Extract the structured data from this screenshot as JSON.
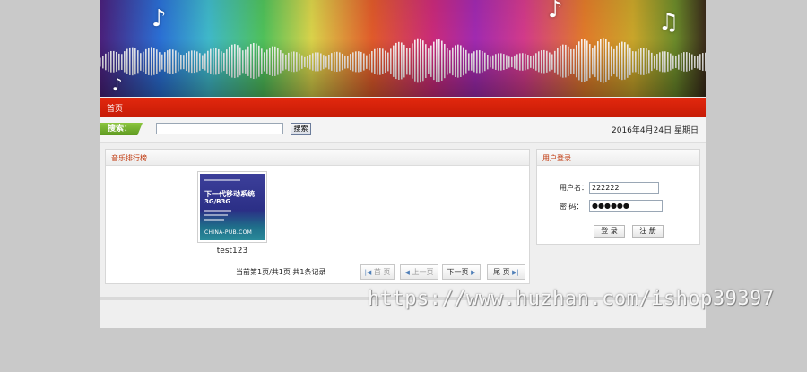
{
  "nav": {
    "home_label": "首页"
  },
  "search": {
    "label": "搜索：",
    "value": "",
    "placeholder": "",
    "button_label": "搜索"
  },
  "date_text": "2016年4月24日  星期日",
  "ranking_panel": {
    "title": "音乐排行榜",
    "song": {
      "name": "test123",
      "cover_title": "下一代移动系统",
      "cover_subtitle": "3G/B3G",
      "cover_brand": "CHINA-PUB.COM"
    },
    "pager": {
      "info": "当前第1页/共1页  共1条记录",
      "first_label": "首 页",
      "prev_label": "上一页",
      "next_label": "下一页",
      "last_label": "尾 页"
    }
  },
  "login_panel": {
    "title": "用户登录",
    "username_label": "用户名：",
    "username_value": "222222",
    "password_label": "密  码：",
    "password_value": "●●●●●●",
    "login_label": "登 录",
    "register_label": "注 册"
  },
  "watermark": "https://www.huzhan.com/ishop39397",
  "colors": {
    "nav_red": "#d8230b",
    "search_green": "#7ab332",
    "panel_title": "#c0390e",
    "page_bg": "#c9c9c9"
  }
}
